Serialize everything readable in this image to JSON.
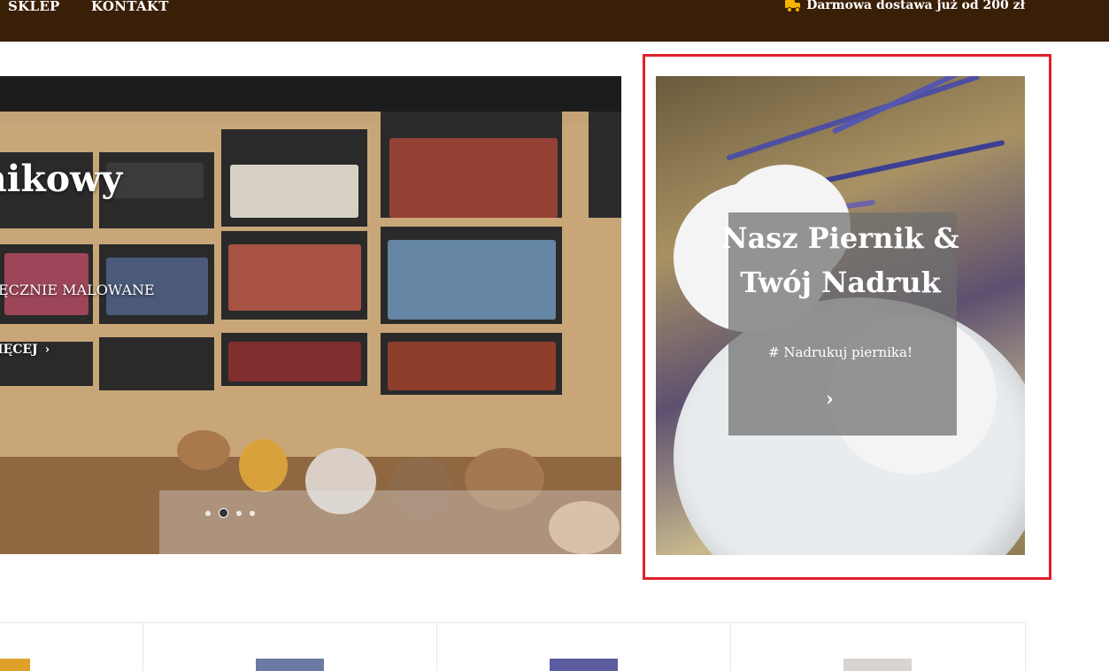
{
  "nav": {
    "items": [
      "SKLEP",
      "KONTAKT"
    ]
  },
  "topbar": {
    "shipping_text": "Darmowa dostawa już od 200 zł",
    "shipping_icon": "truck-icon",
    "background": "#3a1f08",
    "icon_color": "#f5b400"
  },
  "hero": {
    "title": "nikowy",
    "subtitle": "ĘCZNIE MALOWANE",
    "button_label": "IĘCEJ",
    "slider_dots": 4,
    "active_dot": 2
  },
  "promo": {
    "title_line1": "Nasz Piernik &",
    "title_line2": "Twój Nadruk",
    "tagline": "# Nadrukuj piernika!",
    "arrow_icon": "chevron-right-icon",
    "highlight_color": "#e1202d"
  },
  "categories": {
    "count": 4
  }
}
